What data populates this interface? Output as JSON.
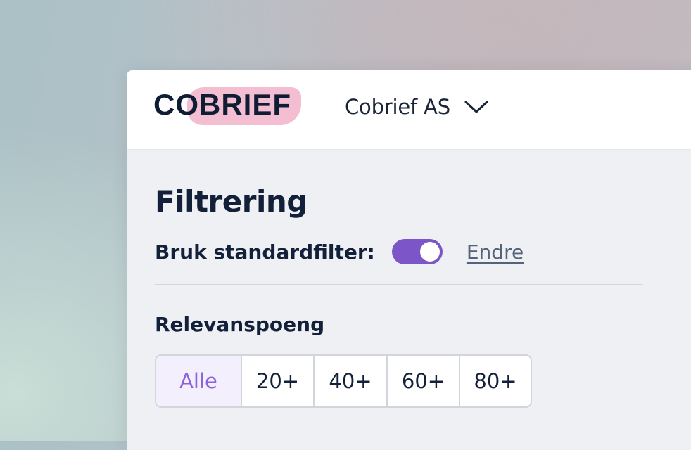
{
  "brand": {
    "logo_text": "COBRIEF"
  },
  "header": {
    "company_name": "Cobrief AS",
    "company_dropdown_icon": "chevron-down-icon"
  },
  "filter_panel": {
    "title": "Filtrering",
    "standard_filter": {
      "label": "Bruk standardfilter:",
      "enabled": true,
      "edit_link": "Endre"
    },
    "relevance": {
      "title": "Relevanspoeng",
      "options": [
        "Alle",
        "20+",
        "40+",
        "60+",
        "80+"
      ],
      "selected": "Alle"
    }
  },
  "colors": {
    "accent": "#7c55c9",
    "logo_highlight": "#f4bed2",
    "text_dark": "#13203a",
    "panel_background": "#eff0f4"
  }
}
